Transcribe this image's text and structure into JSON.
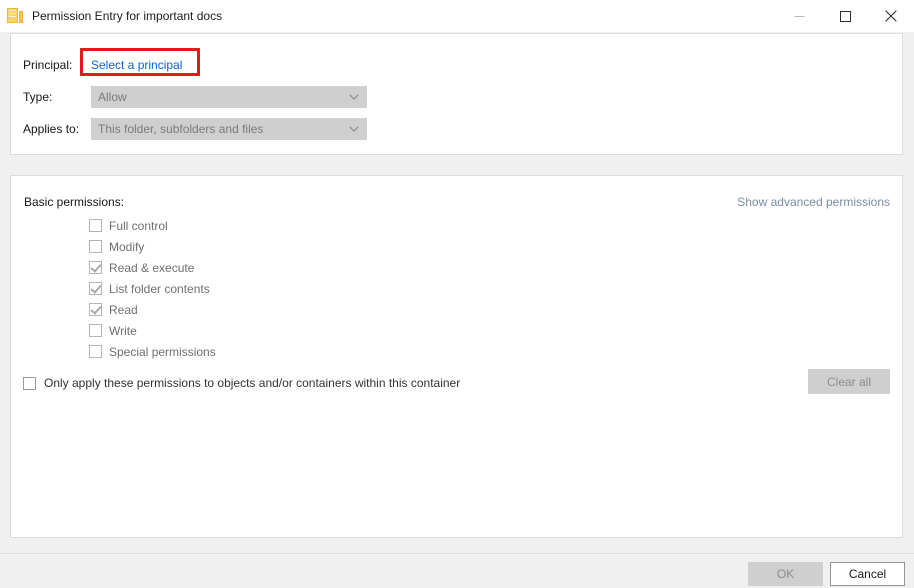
{
  "window": {
    "title": "Permission Entry for important docs",
    "icon": "folder-document-icon",
    "controls": {
      "minimize": "minimize-icon",
      "maximize": "maximize-icon",
      "close": "close-icon"
    }
  },
  "form": {
    "principal_label": "Principal:",
    "principal_link": "Select a principal",
    "type_label": "Type:",
    "type_value": "Allow",
    "applies_label": "Applies to:",
    "applies_value": "This folder, subfolders and files"
  },
  "permissions": {
    "section_label": "Basic permissions:",
    "advanced_link": "Show advanced permissions",
    "items": [
      {
        "label": "Full control",
        "checked": false
      },
      {
        "label": "Modify",
        "checked": false
      },
      {
        "label": "Read & execute",
        "checked": true
      },
      {
        "label": "List folder contents",
        "checked": true
      },
      {
        "label": "Read",
        "checked": true
      },
      {
        "label": "Write",
        "checked": false
      },
      {
        "label": "Special permissions",
        "checked": false
      }
    ],
    "only_apply_label": "Only apply these permissions to objects and/or containers within this container",
    "only_apply_checked": false,
    "clear_all_label": "Clear all"
  },
  "footer": {
    "ok_label": "OK",
    "cancel_label": "Cancel"
  },
  "colors": {
    "link": "#0b63ce",
    "highlight": "#e01b1b",
    "advanced_link": "#7a8ba6",
    "disabled_bg": "#cfcfcf",
    "dialog_bg": "#f0f0f0"
  }
}
